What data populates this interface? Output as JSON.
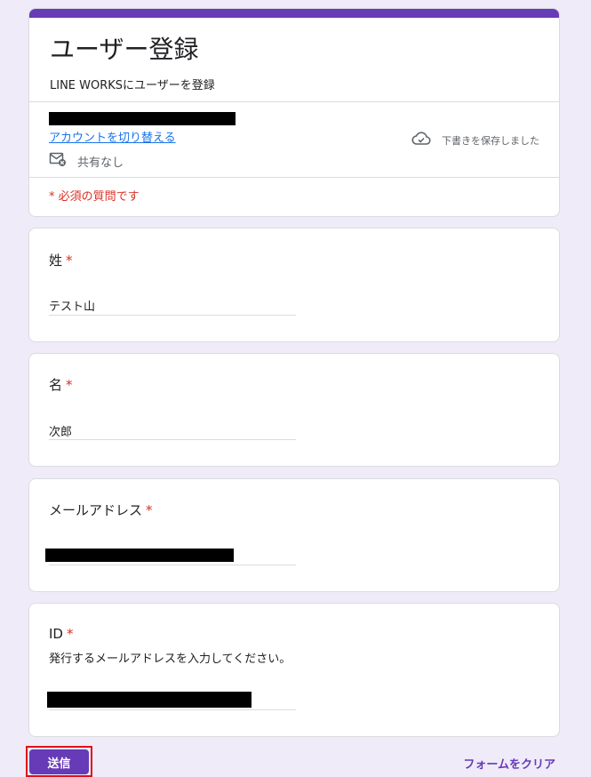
{
  "form": {
    "title": "ユーザー登録",
    "description": "LINE WORKSにユーザーを登録",
    "account_switch": "アカウントを切り替える",
    "sharing_status": "共有なし",
    "draft_status": "下書きを保存しました",
    "required_note": "* 必須の質問です"
  },
  "questions": [
    {
      "label": "姓",
      "required_mark": "*",
      "value": "テスト山"
    },
    {
      "label": "名",
      "required_mark": "*",
      "value": "次郎"
    },
    {
      "label": "メールアドレス",
      "required_mark": "*",
      "value": ""
    },
    {
      "label": "ID",
      "required_mark": "*",
      "help": "発行するメールアドレスを入力してください。",
      "value": ""
    }
  ],
  "footer": {
    "submit_label": "送信",
    "clear_label": "フォームをクリア"
  },
  "colors": {
    "accent": "#673ab7",
    "background": "#efebf8",
    "required": "#d93025",
    "link": "#1a73e8",
    "highlight_outline": "#e0101a"
  },
  "icons": {
    "sharing": "mail-off-icon",
    "draft": "cloud-check-icon"
  }
}
